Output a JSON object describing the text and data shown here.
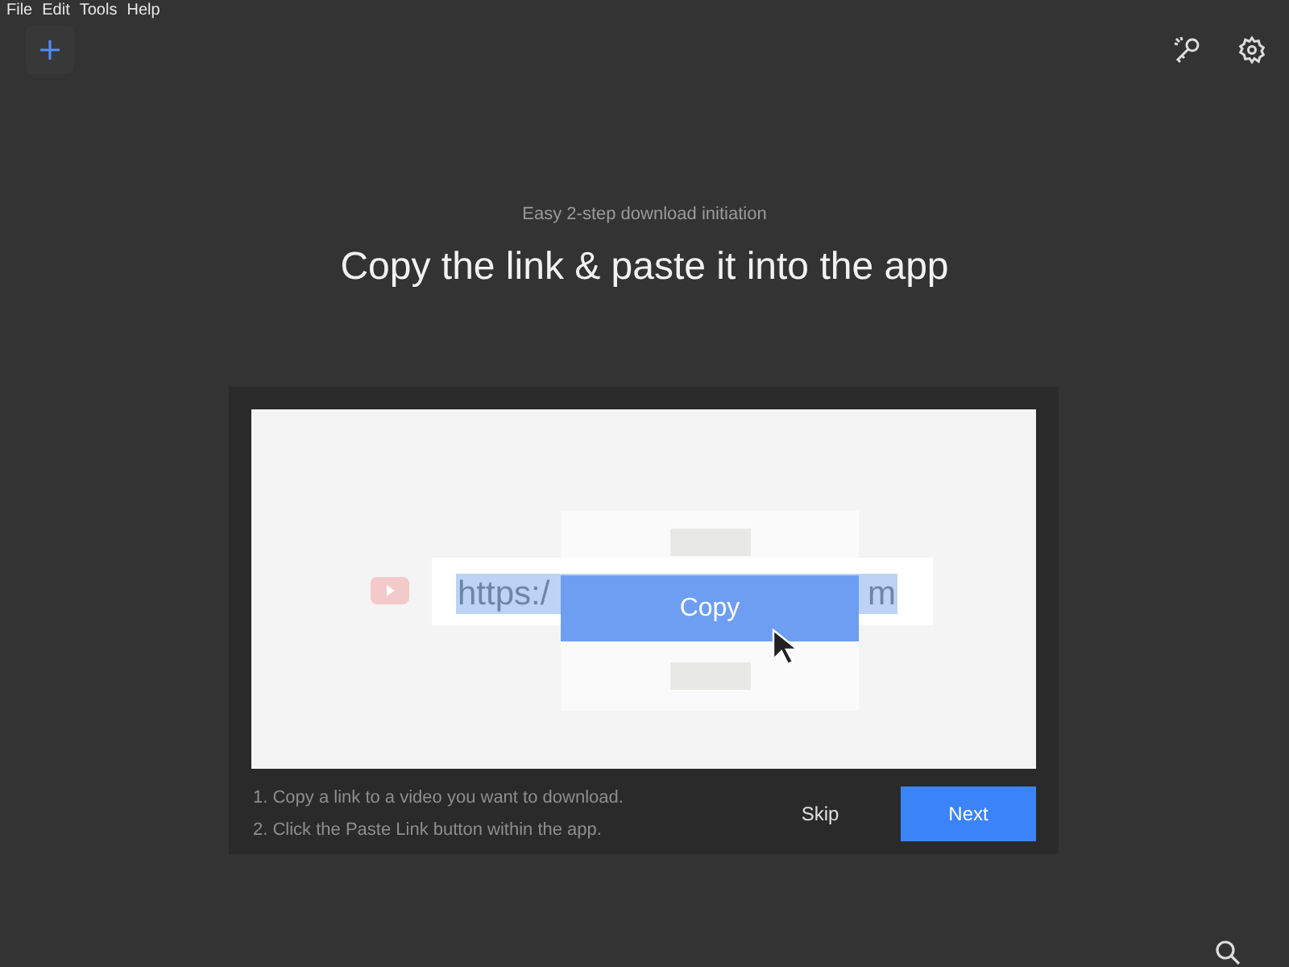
{
  "menu_bar": [
    "File",
    "Edit",
    "Tools",
    "Help"
  ],
  "subtitle": "Easy 2-step download initiation",
  "title": "Copy the link & paste it into the app",
  "illustration": {
    "url_start": "https:/",
    "url_end": "m",
    "menu_item": "Copy"
  },
  "instructions": [
    "1. Copy a link to a video you want to download.",
    "2. Click the Paste Link button within the app."
  ],
  "buttons": [
    {
      "label": "Skip",
      "kind": "text"
    },
    {
      "label": "Next",
      "kind": "primary"
    }
  ]
}
